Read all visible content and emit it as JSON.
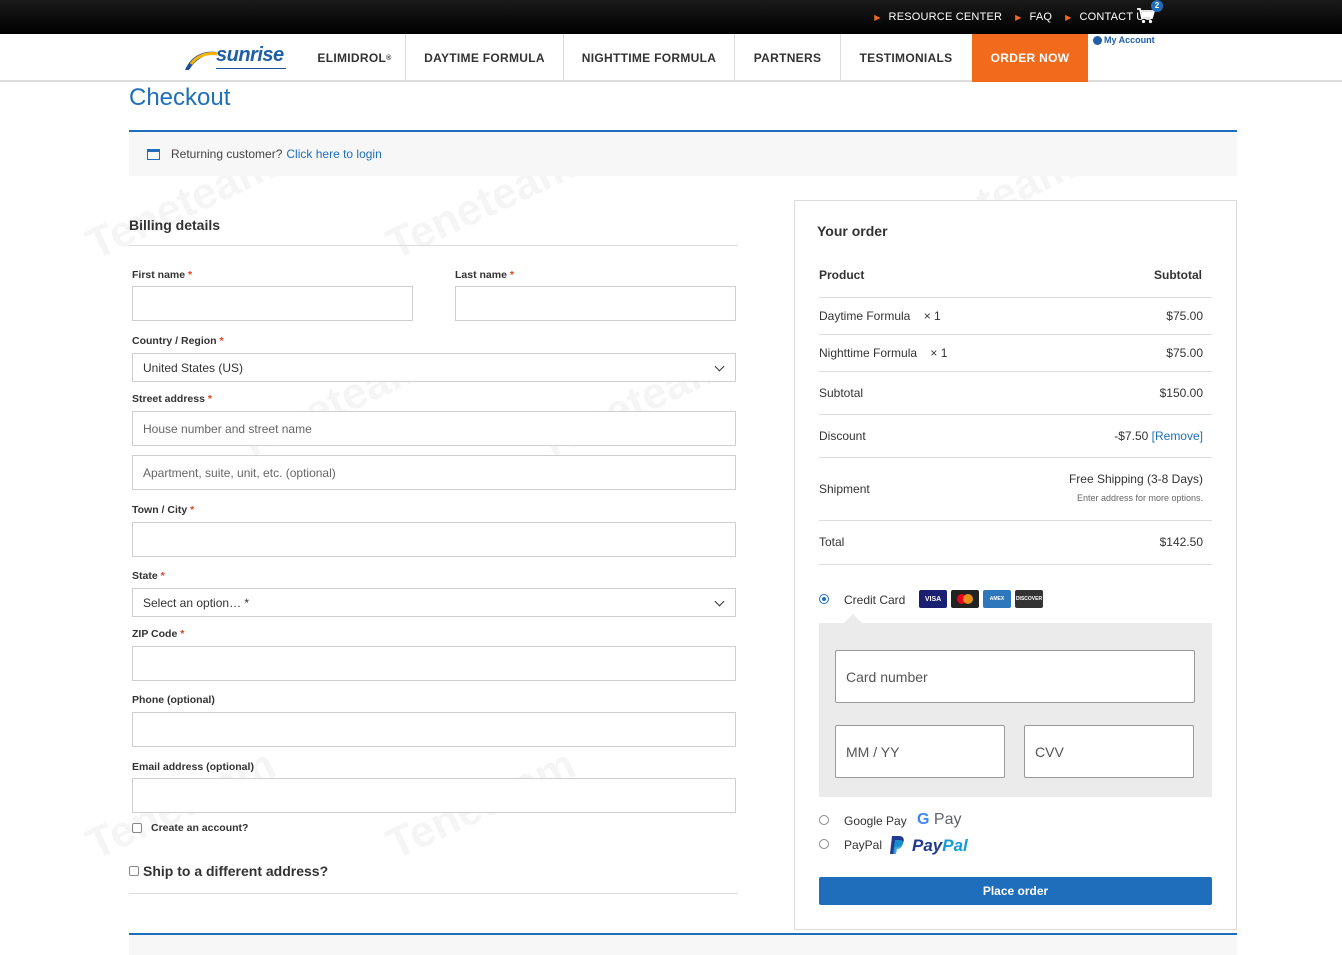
{
  "topbar": {
    "links": [
      "RESOURCE CENTER",
      "FAQ",
      "CONTACT US"
    ],
    "cart_count": "2",
    "my_account": "My Account"
  },
  "nav": {
    "logo": "sunrise",
    "items": [
      "ELIMIDROL",
      "DAYTIME FORMULA",
      "NIGHTTIME FORMULA",
      "PARTNERS",
      "TESTIMONIALS",
      "ORDER NOW"
    ],
    "registered_mark": "®"
  },
  "page": {
    "title": "Checkout",
    "returning_text": "Returning customer?",
    "login_link": "Click here to login"
  },
  "billing": {
    "title": "Billing details",
    "first_name_label": "First name",
    "last_name_label": "Last name",
    "country_label": "Country / Region",
    "country_value": "United States (US)",
    "street_label": "Street address",
    "street_placeholder": "House number and street name",
    "apt_placeholder": "Apartment, suite, unit, etc. (optional)",
    "city_label": "Town / City",
    "state_label": "State",
    "state_value": "Select an option… *",
    "zip_label": "ZIP Code",
    "phone_label": "Phone (optional)",
    "email_label": "Email address (optional)",
    "create_account": "Create an account?",
    "ship_different": "Ship to a different address?",
    "required_mark": "*"
  },
  "order": {
    "title": "Your order",
    "col_product": "Product",
    "col_subtotal": "Subtotal",
    "items": [
      {
        "name": "Daytime Formula",
        "qty": "× 1",
        "price": "$75.00"
      },
      {
        "name": "Nighttime Formula",
        "qty": "× 1",
        "price": "$75.00"
      }
    ],
    "subtotal_label": "Subtotal",
    "subtotal_value": "$150.00",
    "discount_label": "Discount",
    "discount_value": "-$7.50",
    "remove_link": "[Remove]",
    "shipment_label": "Shipment",
    "shipment_value": "Free Shipping (3-8 Days)",
    "shipment_note": "Enter address for more options.",
    "total_label": "Total",
    "total_value": "$142.50"
  },
  "payment": {
    "credit_card_label": "Credit Card",
    "card_logos": [
      "VISA",
      "MC",
      "AMEX",
      "DISCOVER"
    ],
    "card_number_placeholder": "Card number",
    "expiry_placeholder": "MM / YY",
    "cvv_placeholder": "CVV",
    "google_pay_label": "Google Pay",
    "google_pay_logo_g": "G",
    "google_pay_logo_text": "Pay",
    "paypal_label": "PayPal",
    "paypal_logo_a": "Pay",
    "paypal_logo_b": "Pal",
    "place_order": "Place order"
  },
  "watermark": "Teneteam"
}
